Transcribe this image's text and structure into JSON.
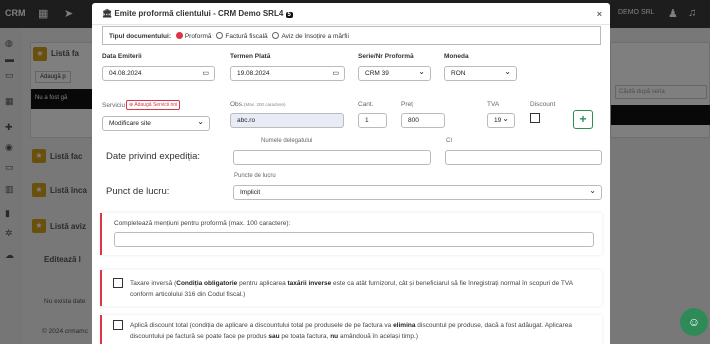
{
  "app": {
    "logo": "CRM",
    "company": "DEMO SRL"
  },
  "background": {
    "panel1_title": "Listă fa",
    "adauga_label": "Adaugă p",
    "nofound_text": "Nu a fost gă",
    "search_placeholder": "Căută după seria",
    "panel2_title": "Listă fac",
    "panel3_title": "Listă înca",
    "panel4_title": "Listă aviz",
    "panel5_title": "Editează l",
    "empty_text": "Nu exista date",
    "footer": "© 2024 crmamc"
  },
  "modal": {
    "title": "Emite proformă clientului - CRM Demo SRL4",
    "badge": "5",
    "close": "×",
    "doc_type_label": "Tipul documentului:",
    "doc_types": [
      "Proformă",
      "Factură fiscală",
      "Aviz de însoțire a mărfii"
    ],
    "selected_doc_type": "Proformă",
    "data_emiterii_label": "Data Emiterii",
    "data_emiterii": "04.08.2024",
    "termen_plata_label": "Termen Plată",
    "termen_plata": "19.08.2024",
    "serie_label": "Serie/Nr Proformă",
    "serie": "CRM 39",
    "moneda_label": "Moneda",
    "moneda": "RON",
    "serviciu_label": "Serviciu",
    "adauga_servicii": "Adaugă Servicii noi",
    "serviciu": "Modificare site",
    "obs_label": "Obs.",
    "obs_hint": "(Max. 200 caractere)",
    "obs": "abc.ro",
    "cant_label": "Cant.",
    "cant": "1",
    "pret_label": "Preț",
    "pret": "800",
    "tva_label": "TVA",
    "tva": "19",
    "discount_label": "Discount",
    "add_button": "+",
    "expeditie_title": "Date privind expediția:",
    "delegat_label": "Numele delegatului",
    "ci_label": "CI",
    "punct_title": "Punct de lucru:",
    "puncte_label": "Puncte de lucru",
    "punct_value": "Implicit",
    "mentiuni_label": "Completează mențiuni pentru proformă (max. 100 caractere):",
    "taxare_text_1": "Taxare inversă (",
    "taxare_bold_1": "Condiția obligatorie",
    "taxare_text_2": " pentru aplicarea ",
    "taxare_bold_2": "taxării inverse",
    "taxare_text_3": " este ca atât furnizorul, cât și beneficiarul să fie înregistrați normal în scopuri de TVA conform articolului 316 din Codul fiscal.)",
    "discount_text_1": "Aplică discount total (condiția de aplicare a discountului total pe produsele de pe factura va ",
    "discount_bold_1": "elimina",
    "discount_text_2": " discountul pe produse, dacă a fost adăugat. Aplicarea discountului pe factură se poate face pe produs ",
    "discount_bold_2": "sau",
    "discount_text_3": " pe toata factura, ",
    "discount_bold_3": "nu",
    "discount_text_4": " amândouă în același timp.)"
  },
  "colors": {
    "accent": "#dc3545",
    "topbar": "#3a3a3a",
    "green": "#2e8b57",
    "star": "#d4a01a"
  }
}
